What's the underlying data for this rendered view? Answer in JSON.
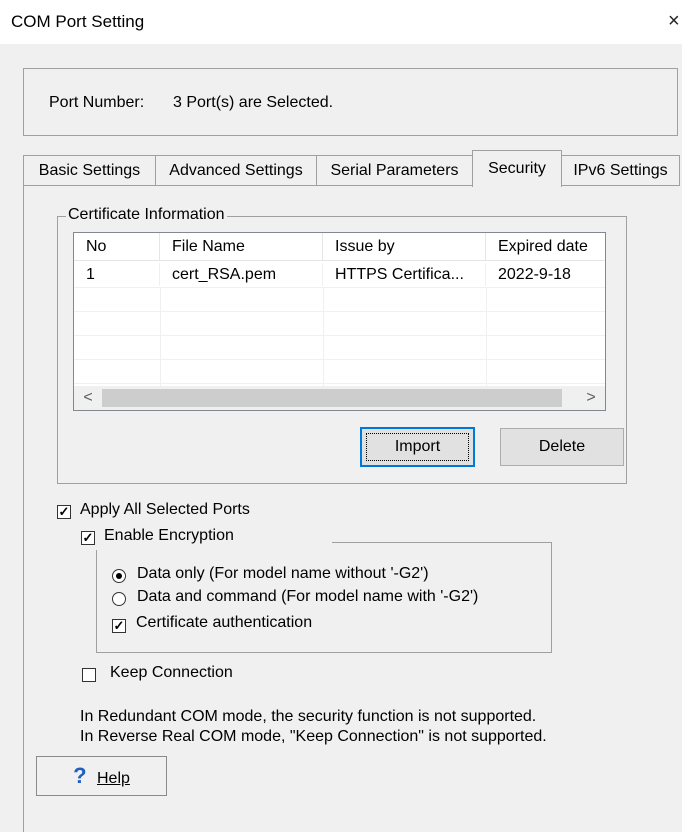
{
  "window": {
    "title": "COM Port Setting",
    "close_glyph": "×"
  },
  "port": {
    "label": "Port Number:",
    "value": "3 Port(s) are Selected."
  },
  "tabs": [
    {
      "label": "Basic Settings"
    },
    {
      "label": "Advanced Settings"
    },
    {
      "label": "Serial Parameters"
    },
    {
      "label": "Security",
      "active": true
    },
    {
      "label": "IPv6 Settings"
    }
  ],
  "certificate": {
    "group_title": "Certificate Information",
    "columns": [
      "No",
      "File Name",
      "Issue by",
      "Expired date"
    ],
    "rows": [
      [
        "1",
        "cert_RSA.pem",
        "HTTPS Certifica...",
        "2022-9-18"
      ]
    ],
    "scroll_left": "<",
    "scroll_right": ">",
    "import_label": "Import",
    "delete_label": "Delete"
  },
  "options": {
    "apply_all": {
      "label": "Apply All Selected Ports",
      "checked": true
    },
    "enable_encryption": {
      "label": "Enable Encryption",
      "checked": true
    },
    "data_only": {
      "label": "Data only (For model name without '-G2')",
      "selected": true
    },
    "data_and_command": {
      "label": "Data and command  (For model name with '-G2')",
      "selected": false
    },
    "cert_auth": {
      "label": "Certificate authentication",
      "checked": true
    },
    "keep_connection": {
      "label": "Keep Connection",
      "checked": false
    }
  },
  "notes": {
    "line1": "In Redundant COM mode,  the security function is not supported.",
    "line2": "In Reverse Real COM mode, \"Keep Connection\" is not supported."
  },
  "help": {
    "icon": "?",
    "label": "Help"
  },
  "checkmark": "✓",
  "colors": {
    "focus_border": "#0078d7",
    "help_icon": "#1f5fc4"
  }
}
